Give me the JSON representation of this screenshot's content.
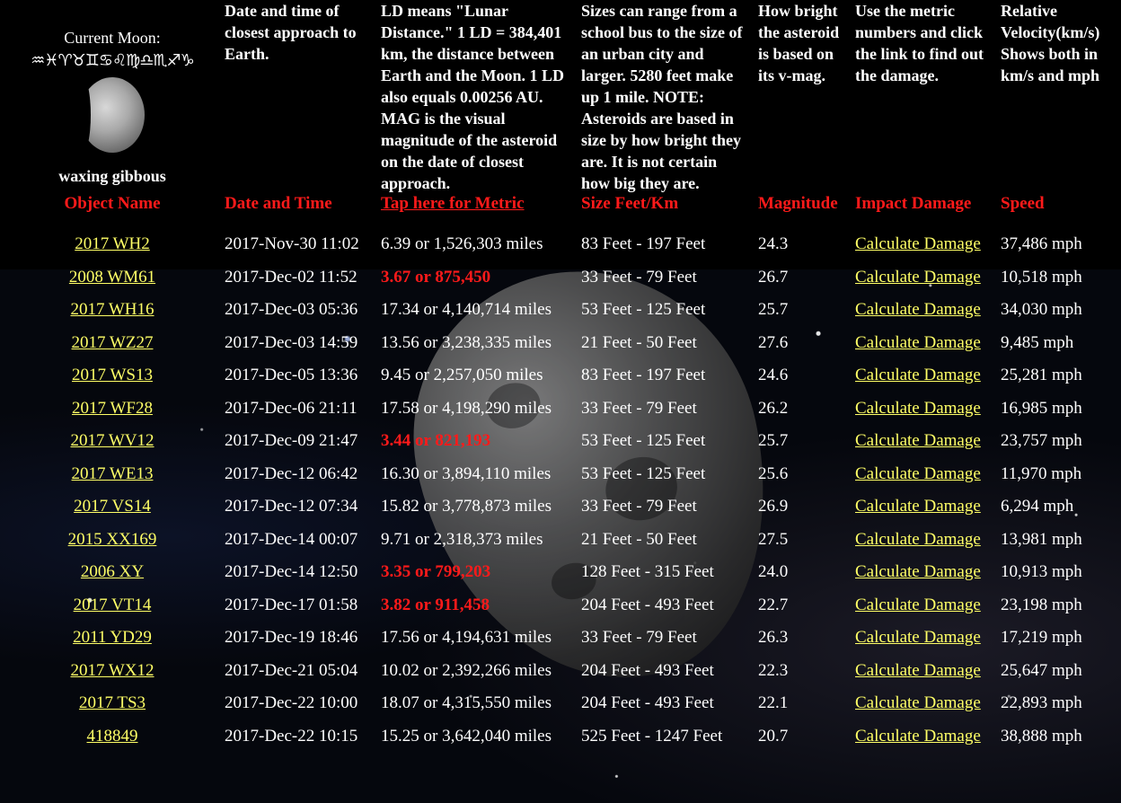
{
  "moon": {
    "title": "Current Moon:",
    "glyphs": "♒♓♈♉♊♋♌♍♎♏♐♑",
    "phase": "waxing gibbous"
  },
  "header_notes": {
    "date": "Date and time of closest approach to Earth.",
    "distance": "LD means \"Lunar Distance.\" 1 LD = 384,401 km, the distance between Earth and the Moon. 1 LD also equals 0.00256 AU. MAG is the visual magnitude of the asteroid on the date of closest approach.",
    "size": "Sizes can range from a school bus to the size of an urban city and larger. 5280 feet make up 1 mile. NOTE: Asteroids are based in size by how bright they are. It is not certain how big they are.",
    "magnitude": "How bright the asteroid is based on its v-mag.",
    "damage": "Use the metric numbers and click the link to find out the damage.",
    "speed": "Relative Velocity(km/s) Shows both in km/s and mph"
  },
  "columns": {
    "name": "Object Name",
    "date": "Date and Time",
    "distance": "Tap here for Metric",
    "size": "Size Feet/Km",
    "magnitude": "Magnitude",
    "damage": "Impact Damage",
    "speed": "Speed"
  },
  "rows": [
    {
      "name": "2017 WH2",
      "date": "2017-Nov-30 11:02",
      "distance": "6.39 or 1,526,303 miles",
      "close": false,
      "size": "83 Feet - 197 Feet",
      "mag": "24.3",
      "damage": "Calculate Damage",
      "speed": "37,486 mph"
    },
    {
      "name": "2008 WM61",
      "date": "2017-Dec-02 11:52",
      "distance": "3.67 or 875,450",
      "close": true,
      "size": "33 Feet - 79 Feet",
      "mag": "26.7",
      "damage": "Calculate Damage",
      "speed": "10,518 mph"
    },
    {
      "name": "2017 WH16",
      "date": "2017-Dec-03 05:36",
      "distance": "17.34 or 4,140,714 miles",
      "close": false,
      "size": "53 Feet - 125 Feet",
      "mag": "25.7",
      "damage": "Calculate Damage",
      "speed": "34,030 mph"
    },
    {
      "name": "2017 WZ27",
      "date": "2017-Dec-03 14:59",
      "distance": "13.56 or 3,238,335 miles",
      "close": false,
      "size": "21 Feet - 50 Feet",
      "mag": "27.6",
      "damage": "Calculate Damage",
      "speed": "9,485 mph"
    },
    {
      "name": "2017 WS13",
      "date": "2017-Dec-05 13:36",
      "distance": "9.45 or 2,257,050 miles",
      "close": false,
      "size": "83 Feet - 197 Feet",
      "mag": "24.6",
      "damage": "Calculate Damage",
      "speed": "25,281 mph"
    },
    {
      "name": "2017 WF28",
      "date": "2017-Dec-06 21:11",
      "distance": "17.58 or 4,198,290 miles",
      "close": false,
      "size": "33 Feet - 79 Feet",
      "mag": "26.2",
      "damage": "Calculate Damage",
      "speed": "16,985 mph"
    },
    {
      "name": "2017 WV12",
      "date": "2017-Dec-09 21:47",
      "distance": "3.44 or 821,193",
      "close": true,
      "size": "53 Feet - 125 Feet",
      "mag": "25.7",
      "damage": "Calculate Damage",
      "speed": "23,757 mph"
    },
    {
      "name": "2017 WE13",
      "date": "2017-Dec-12 06:42",
      "distance": "16.30 or 3,894,110 miles",
      "close": false,
      "size": "53 Feet - 125 Feet",
      "mag": "25.6",
      "damage": "Calculate Damage",
      "speed": "11,970 mph"
    },
    {
      "name": "2017 VS14",
      "date": "2017-Dec-12 07:34",
      "distance": "15.82 or 3,778,873 miles",
      "close": false,
      "size": "33 Feet - 79 Feet",
      "mag": "26.9",
      "damage": "Calculate Damage",
      "speed": "6,294 mph"
    },
    {
      "name": "2015 XX169",
      "date": "2017-Dec-14 00:07",
      "distance": "9.71 or 2,318,373 miles",
      "close": false,
      "size": "21 Feet - 50 Feet",
      "mag": "27.5",
      "damage": "Calculate Damage",
      "speed": "13,981 mph"
    },
    {
      "name": "2006 XY",
      "date": "2017-Dec-14 12:50",
      "distance": "3.35 or 799,203",
      "close": true,
      "size": "128 Feet - 315 Feet",
      "mag": "24.0",
      "damage": "Calculate Damage",
      "speed": "10,913 mph"
    },
    {
      "name": "2017 VT14",
      "date": "2017-Dec-17 01:58",
      "distance": "3.82 or 911,458",
      "close": true,
      "size": "204 Feet - 493 Feet",
      "mag": "22.7",
      "damage": "Calculate Damage",
      "speed": "23,198 mph"
    },
    {
      "name": "2011 YD29",
      "date": "2017-Dec-19 18:46",
      "distance": "17.56 or 4,194,631 miles",
      "close": false,
      "size": "33 Feet - 79 Feet",
      "mag": "26.3",
      "damage": "Calculate Damage",
      "speed": "17,219 mph"
    },
    {
      "name": "2017 WX12",
      "date": "2017-Dec-21 05:04",
      "distance": "10.02 or 2,392,266 miles",
      "close": false,
      "size": "204 Feet - 493 Feet",
      "mag": "22.3",
      "damage": "Calculate Damage",
      "speed": "25,647 mph"
    },
    {
      "name": "2017 TS3",
      "date": "2017-Dec-22 10:00",
      "distance": "18.07 or 4,315,550 miles",
      "close": false,
      "size": "204 Feet - 493 Feet",
      "mag": "22.1",
      "damage": "Calculate Damage",
      "speed": "22,893 mph"
    },
    {
      "name": "418849",
      "date": "2017-Dec-22 10:15",
      "distance": "15.25 or 3,642,040 miles",
      "close": false,
      "size": "525 Feet - 1247 Feet",
      "mag": "20.7",
      "damage": "Calculate Damage",
      "speed": "38,888 mph"
    }
  ]
}
